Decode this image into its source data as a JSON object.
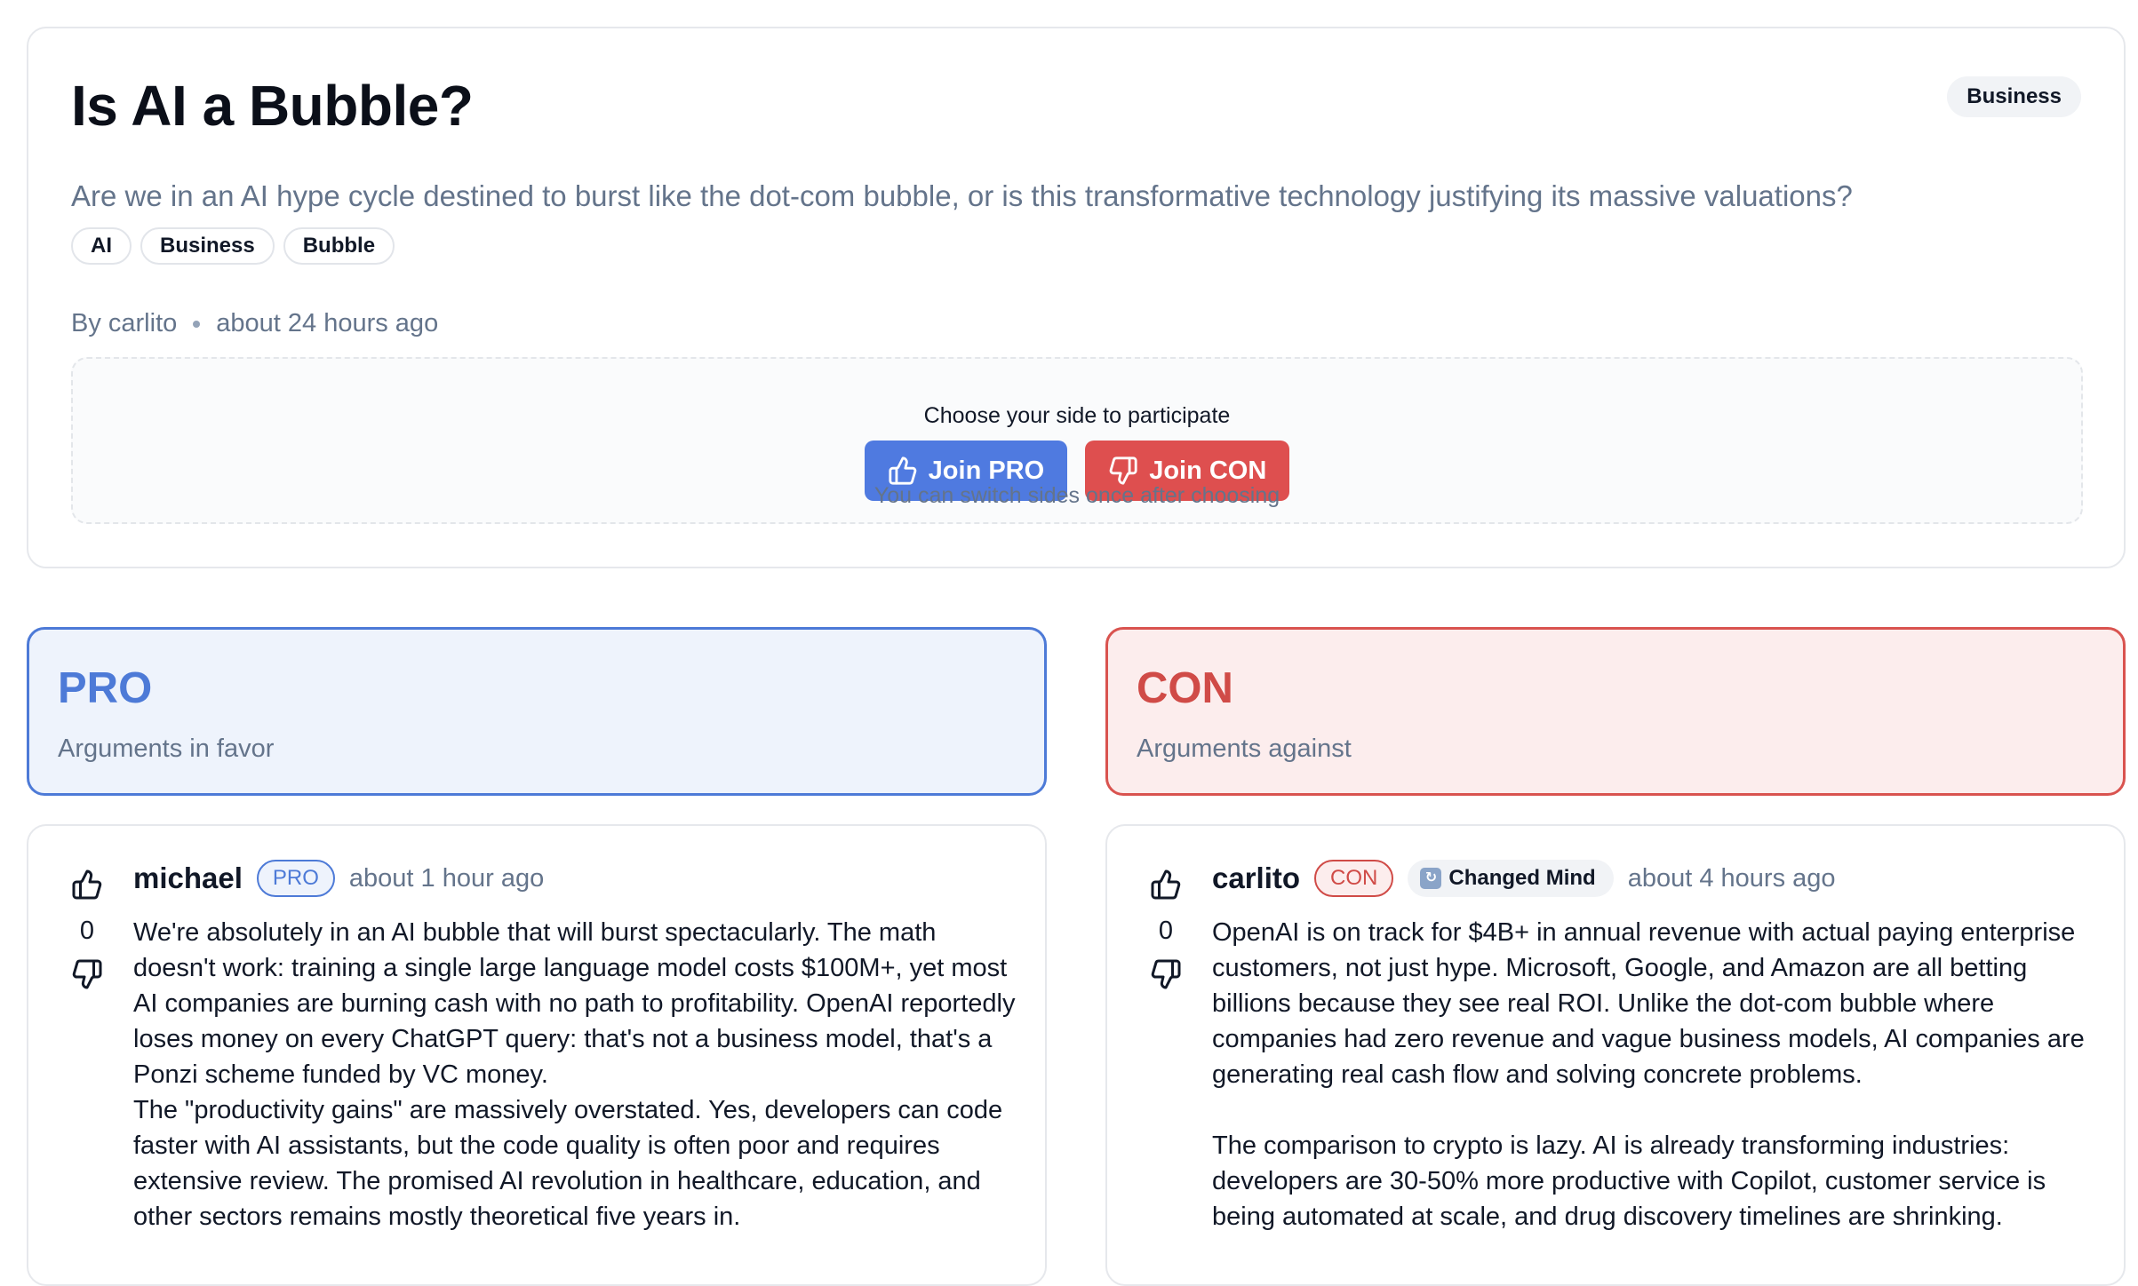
{
  "debate": {
    "title": "Is AI a Bubble?",
    "category": "Business",
    "description": "Are we in an AI hype cycle destined to burst like the dot-com bubble, or is this transformative technology justifying its massive valuations?",
    "tags": [
      "AI",
      "Business",
      "Bubble"
    ],
    "author_line": "By carlito",
    "time": "about 24 hours ago"
  },
  "join": {
    "title": "Choose your side to participate",
    "pro_label": "Join PRO",
    "con_label": "Join CON",
    "note": "You can switch sides once after choosing"
  },
  "sides": {
    "pro": {
      "title": "PRO",
      "subtitle": "Arguments in favor"
    },
    "con": {
      "title": "CON",
      "subtitle": "Arguments against"
    }
  },
  "arguments": {
    "pro": {
      "author": "michael",
      "badge": "PRO",
      "time": "about 1 hour ago",
      "votes": "0",
      "paragraphs": [
        "We're absolutely in an AI bubble that will burst spectacularly. The math doesn't work: training a single large language model costs $100M+, yet most AI companies are burning cash with no path to profitability. OpenAI reportedly loses money on every ChatGPT query: that's not a business model, that's a Ponzi scheme funded by VC money.",
        "The \"productivity gains\" are massively overstated. Yes, developers can code faster with AI assistants, but the code quality is often poor and requires extensive review. The promised AI revolution in healthcare, education, and other sectors remains mostly theoretical five years in."
      ]
    },
    "con": {
      "author": "carlito",
      "badge": "CON",
      "changed_mind": "Changed Mind",
      "time": "about 4 hours ago",
      "votes": "0",
      "paragraphs": [
        "OpenAI is on track for $4B+ in annual revenue with actual paying enterprise customers, not just hype. Microsoft, Google, and Amazon are all betting billions because they see real ROI. Unlike the dot-com bubble where companies had zero revenue and vague business models, AI companies are generating real cash flow and solving concrete problems.",
        "The comparison to crypto is lazy. AI is already transforming industries: developers are 30-50% more productive with Copilot, customer service is being automated at scale, and drug discovery timelines are shrinking."
      ]
    }
  },
  "icons": {
    "upvote": "thumbs-up-icon",
    "downvote": "thumbs-down-icon",
    "changed_mind": "refresh-icon"
  },
  "colors": {
    "pro": "#4d7ad7",
    "con": "#d04b47",
    "muted": "#64748b"
  }
}
